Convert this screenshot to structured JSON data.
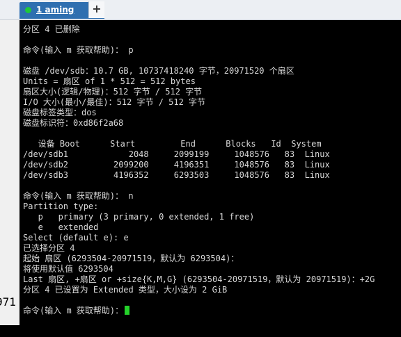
{
  "tab": {
    "label": "1 aming",
    "close": "×",
    "new_tab": "+"
  },
  "left_edge": {
    "text1": "971",
    "text2": "971"
  },
  "terminal_lines": [
    "分区 4 已删除",
    "",
    "命令(输入 m 获取帮助)： p",
    "",
    "磁盘 /dev/sdb：10.7 GB, 10737418240 字节，20971520 个扇区",
    "Units = 扇区 of 1 * 512 = 512 bytes",
    "扇区大小(逻辑/物理)：512 字节 / 512 字节",
    "I/O 大小(最小/最佳)：512 字节 / 512 字节",
    "磁盘标签类型：dos",
    "磁盘标识符：0xd86f2a68",
    "",
    "   设备 Boot      Start         End      Blocks   Id  System",
    "/dev/sdb1            2048     2099199     1048576   83  Linux",
    "/dev/sdb2         2099200     4196351     1048576   83  Linux",
    "/dev/sdb3         4196352     6293503     1048576   83  Linux",
    "",
    "命令(输入 m 获取帮助)： n",
    "Partition type:",
    "   p   primary (3 primary, 0 extended, 1 free)",
    "   e   extended",
    "Select (default e): e",
    "已选择分区 4",
    "起始 扇区 (6293504-20971519，默认为 6293504)：",
    "将使用默认值 6293504",
    "Last 扇区, +扇区 or +size{K,M,G} (6293504-20971519，默认为 20971519)：+2G",
    "分区 4 已设置为 Extended 类型，大小设为 2 GiB",
    "",
    "命令(输入 m 获取帮助)："
  ],
  "colors": {
    "background": "#000000",
    "text": "#d9d9d9",
    "cursor": "#24d12a",
    "tab": "#2f6fb0"
  }
}
